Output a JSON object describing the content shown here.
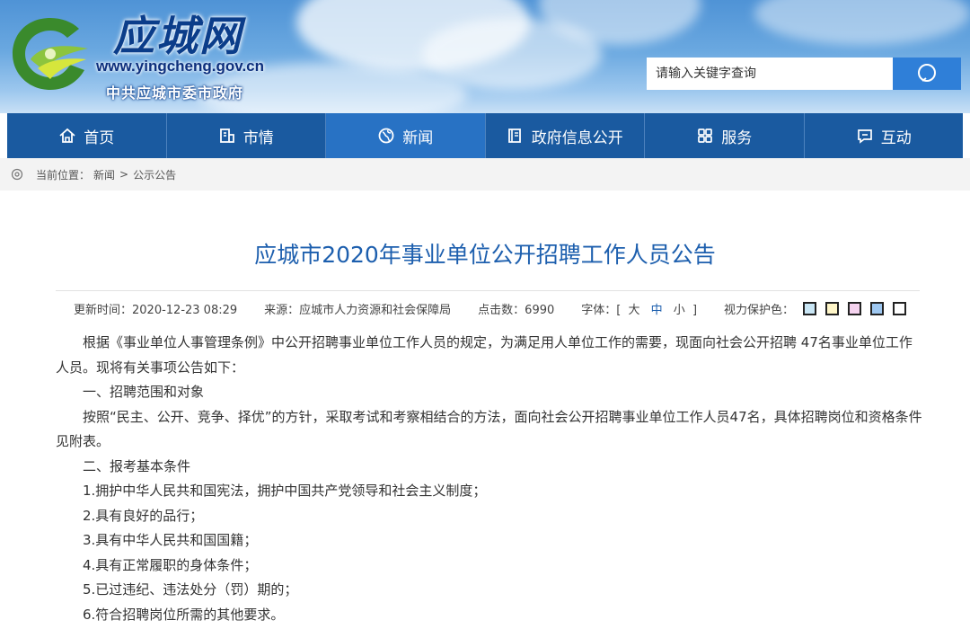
{
  "header": {
    "site_name": "应城网",
    "url": "www.yingcheng.gov.cn",
    "org": "中共应城市委市政府",
    "search_placeholder": "请输入关键字查询"
  },
  "nav": [
    {
      "label": "首页",
      "icon": "home-icon"
    },
    {
      "label": "市情",
      "icon": "city-info-icon"
    },
    {
      "label": "新闻",
      "icon": "globe-icon"
    },
    {
      "label": "政府信息公开",
      "icon": "book-icon"
    },
    {
      "label": "服务",
      "icon": "grid-icon"
    },
    {
      "label": "互动",
      "icon": "chat-icon"
    }
  ],
  "breadcrumb": {
    "prefix": "当前位置：",
    "level1": "新闻",
    "separator": ">",
    "level2": "公示公告"
  },
  "article": {
    "title": "应城市2020年事业单位公开招聘工作人员公告",
    "updated": "更新时间：2020-12-23 08:29",
    "source": "来源：应城市人力资源和社会保障局",
    "clicks": "点击数：6990",
    "font_label": "字体：[",
    "font_large": "大",
    "font_medium": "中",
    "font_small": "小",
    "font_close": "]",
    "eye_label": "视力保护色：",
    "eye_colors": [
      "#c9e6f5",
      "#fff6c8",
      "#f5d3ef",
      "#9ec7f0",
      "#ffffff"
    ],
    "paragraphs": [
      "根据《事业单位人事管理条例》中公开招聘事业单位工作人员的规定，为满足用人单位工作的需要，现面向社会公开招聘 47名事业单位工作人员。现将有关事项公告如下：",
      "一、招聘范围和对象",
      "按照“民主、公开、竞争、择优”的方针，采取考试和考察相结合的方法，面向社会公开招聘事业单位工作人员47名，具体招聘岗位和资格条件见附表。",
      "二、报考基本条件",
      "1.拥护中华人民共和国宪法，拥护中国共产党领导和社会主义制度；",
      "2.具有良好的品行；",
      "3.具有中华人民共和国国籍；",
      "4.具有正常履职的身体条件；",
      "5.已过违纪、违法处分（罚）期的；",
      "6.符合招聘岗位所需的其他要求。"
    ]
  },
  "colors": {
    "nav_bg": "#1a5aa0",
    "nav_active": "#2872c4",
    "title": "#1d5fae",
    "search_button": "#2f7fd8"
  }
}
